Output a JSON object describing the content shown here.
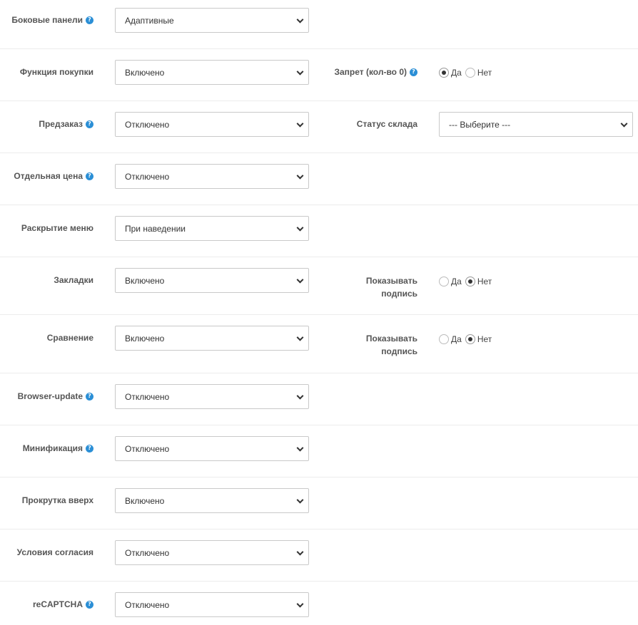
{
  "rows": [
    {
      "label": "Боковые панели",
      "value": "Адаптивные"
    },
    {
      "label": "Функция покупки",
      "value": "Включено"
    },
    {
      "label": "Предзаказ",
      "value": "Отключено"
    },
    {
      "label": "Отдельная цена",
      "value": "Отключено"
    },
    {
      "label": "Раскрытие меню",
      "value": "При наведении"
    },
    {
      "label": "Закладки",
      "value": "Включено"
    },
    {
      "label": "Сравнение",
      "value": "Включено"
    },
    {
      "label": "Browser-update",
      "value": "Отключено"
    },
    {
      "label": "Минификация",
      "value": "Отключено"
    },
    {
      "label": "Прокрутка вверх",
      "value": "Включено"
    },
    {
      "label": "Условия согласия",
      "value": "Отключено"
    },
    {
      "label": "reCAPTCHA",
      "value": "Отключено"
    }
  ],
  "purchase_ban": {
    "label": "Запрет (кол-во 0)",
    "yes": "Да",
    "no": "Нет",
    "selected": "yes"
  },
  "stock_status": {
    "label": "Статус склада",
    "value": "--- Выберите ---"
  },
  "bookmarks_caption": {
    "label": "Показывать подпись",
    "yes": "Да",
    "no": "Нет",
    "selected": "no"
  },
  "compare_caption": {
    "label": "Показывать подпись",
    "yes": "Да",
    "no": "Нет",
    "selected": "no"
  },
  "help_icon_glyph": "?"
}
